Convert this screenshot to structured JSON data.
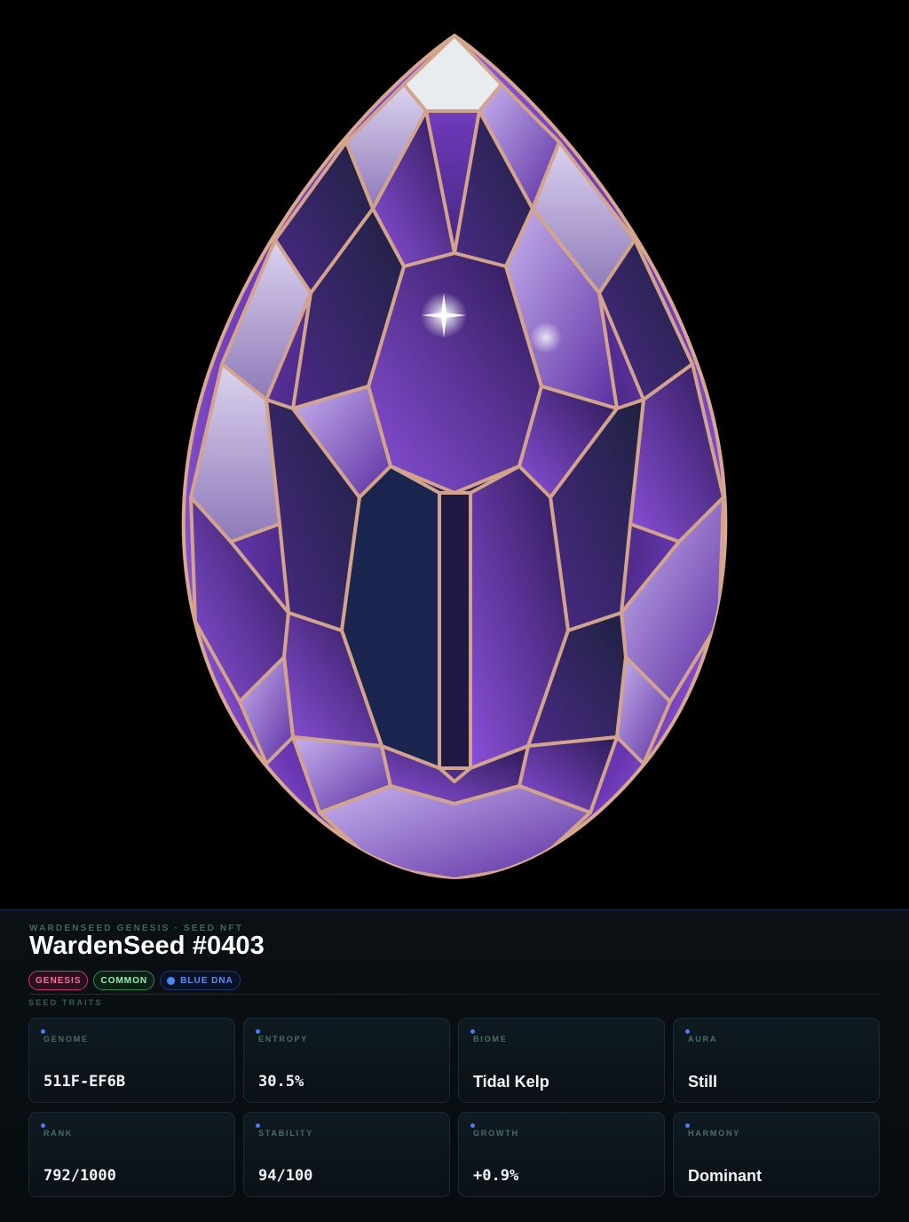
{
  "collection": "WARDENSEED GENESIS · SEED NFT",
  "title": "WardenSeed #0403",
  "tags": {
    "genesis": "GENESIS",
    "common": "COMMON",
    "dna": "BLUE DNA"
  },
  "section_label": "SEED TRAITS",
  "traits": [
    {
      "label": "GENOME",
      "value": "511F-EF6B"
    },
    {
      "label": "ENTROPY",
      "value": "30.5%"
    },
    {
      "label": "BIOME",
      "value": "Tidal Kelp"
    },
    {
      "label": "AURA",
      "value": "Still"
    },
    {
      "label": "RANK",
      "value": "792/1000"
    },
    {
      "label": "STABILITY",
      "value": "94/100"
    },
    {
      "label": "GROWTH",
      "value": "+0.9%"
    },
    {
      "label": "HARMONY",
      "value": "Dominant"
    }
  ],
  "colors": {
    "background": "#000000",
    "panel": "#0a1014",
    "gem_purple": "#7b3fc4",
    "gem_frame": "#c89a8a",
    "accent_blue": "#4f86f7",
    "genesis_pink": "#ff6aa8",
    "common_green": "#8cf2b1"
  },
  "hero_image": "faceted-amethyst-egg-gem"
}
